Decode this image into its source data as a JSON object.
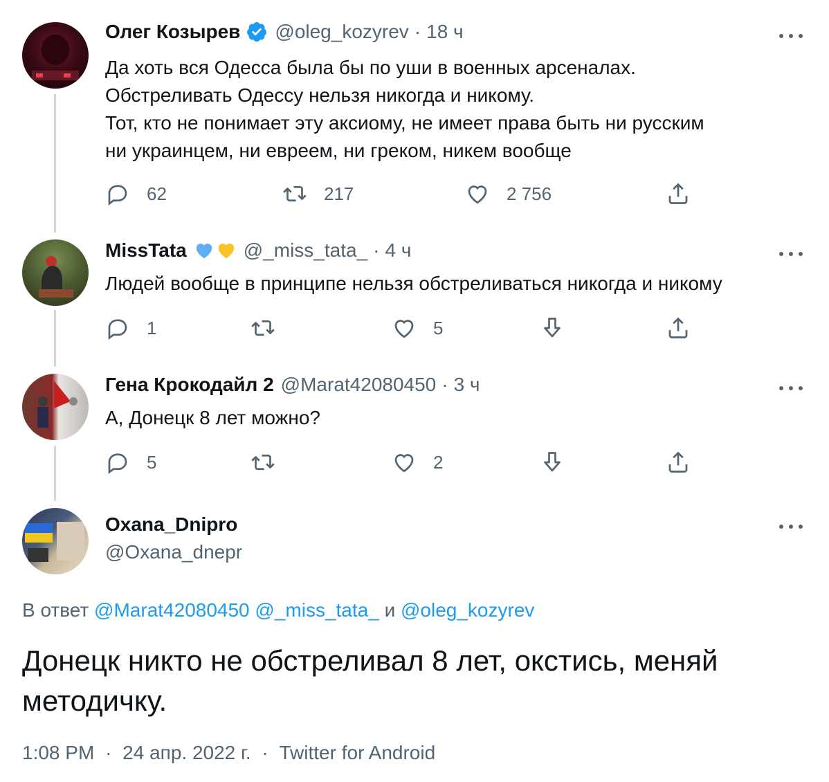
{
  "tweets": [
    {
      "name": "Олег Козырев",
      "handle": "@oleg_kozyrev",
      "separator": "·",
      "time": "18 ч",
      "verified": true,
      "text_lines": [
        "Да хоть вся Одесса была бы по уши в военных арсеналах.",
        "Обстреливать Одессу нельзя никогда и никому.",
        "Тот, кто не понимает эту аксиому, не имеет права быть ни русским",
        "ни украинцем, ни евреем, ни греком, никем вообще"
      ],
      "replies": "62",
      "retweets": "217",
      "likes": "2 756"
    },
    {
      "name": "MissTata",
      "handle": "@_miss_tata_",
      "separator": "·",
      "time": "4 ч",
      "emoji_hearts": [
        "#5daef5",
        "#f7c325"
      ],
      "text_lines": [
        "Людей вообще в принципе нельзя обстреливаться никогда и никому"
      ],
      "replies": "1",
      "retweets": "",
      "likes": "5"
    },
    {
      "name": "Гена Крокодайл 2",
      "handle": "@Marat42080450",
      "separator": "·",
      "time": "3 ч",
      "text_lines": [
        "А, Донецк 8 лет можно?"
      ],
      "replies": "5",
      "retweets": "",
      "likes": "2"
    }
  ],
  "main_tweet": {
    "name": "Oxana_Dnipro",
    "handle": "@Oxana_dnepr",
    "reply_prefix": "В ответ",
    "reply_mentions": [
      "@Marat42080450",
      "@_miss_tata_",
      "@oleg_kozyrev"
    ],
    "reply_and": "и",
    "text_lines": [
      "Донецк никто не обстреливал 8 лет, окстись, меняй",
      "методичку."
    ],
    "time": "1:08 PM",
    "date": "24 апр. 2022 г.",
    "source": "Twitter for Android",
    "separator": "·"
  },
  "colors": {
    "accent": "#1d9bf0",
    "muted": "#536471",
    "text": "#0f1419",
    "thread_line": "#cfd9de"
  },
  "icons": [
    "reply-icon",
    "retweet-icon",
    "like-icon",
    "downvote-icon",
    "share-icon",
    "more-icon",
    "verified-badge-icon"
  ]
}
